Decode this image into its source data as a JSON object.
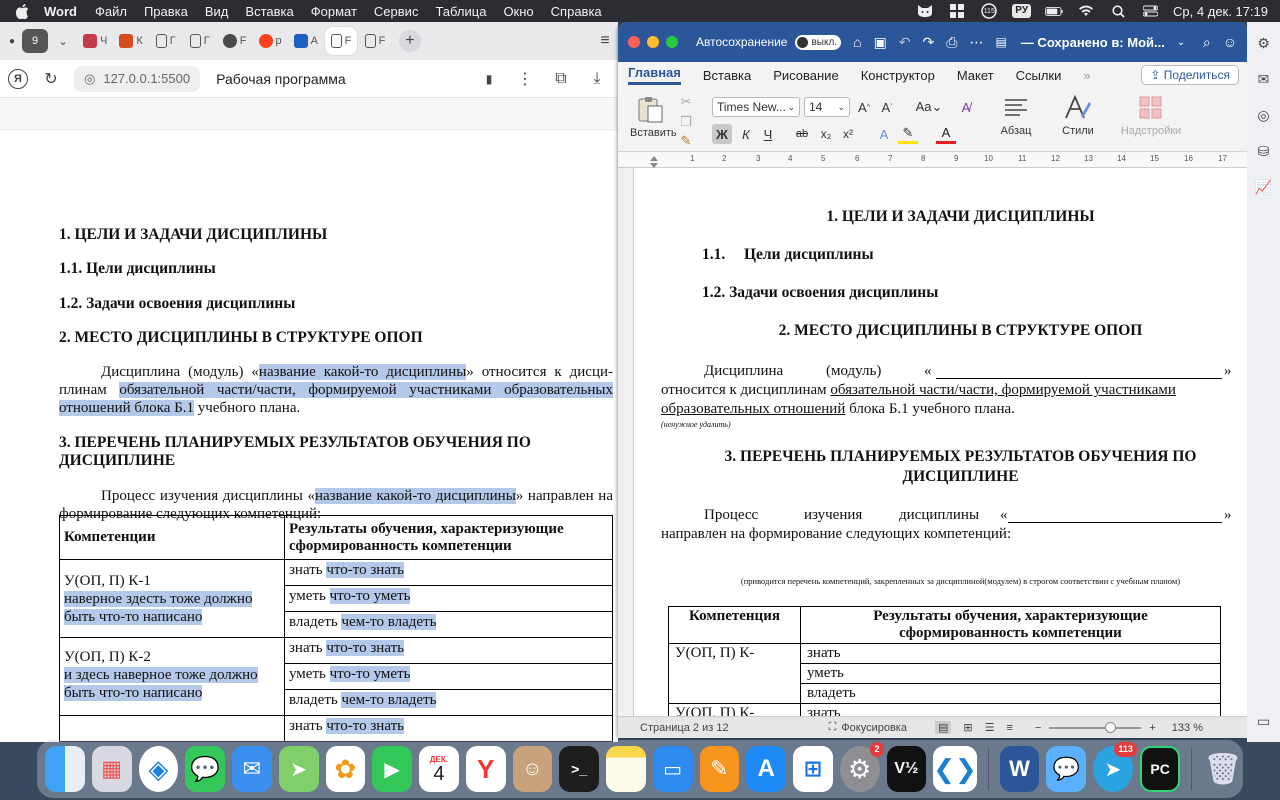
{
  "menubar": {
    "app": "Word",
    "items": [
      "Файл",
      "Правка",
      "Вид",
      "Вставка",
      "Формат",
      "Сервис",
      "Таблица",
      "Окно",
      "Справка"
    ],
    "kb_layout": "РУ",
    "clock": "Ср, 4 дек.  17:19",
    "notif_count": "115"
  },
  "browser": {
    "tab_count": "9",
    "tabs": [
      "Ч",
      "К",
      "Г",
      "Г",
      "F",
      "р",
      "А",
      "F",
      "F"
    ],
    "url": "127.0.0.1:5500",
    "page_title": "Рабочая программа",
    "doc": {
      "h1": "1. ЦЕЛИ И ЗАДАЧИ ДИСЦИПЛИНЫ",
      "h11": "1.1. Цели дисциплины",
      "h12": "1.2. Задачи освоения дисциплины",
      "h2": "2. МЕСТО ДИСЦИПЛИНЫ В СТРУКТУРЕ ОПОП",
      "p1_a": "Дисциплина (модуль) «",
      "p1_hl1": "название какой-то дисциплины",
      "p1_b": "» относится к дисци-плинам ",
      "p1_hl2": "обязательной части/части, формируемой участниками образовательных отношений блока Б.1",
      "p1_c": " учебного плана.",
      "h3": "3. ПЕРЕЧЕНЬ ПЛАНИРУЕМЫХ РЕЗУЛЬТАТОВ ОБУЧЕНИЯ ПО ДИСЦИПЛИНЕ",
      "p2_a": "Процесс изучения дисциплины «",
      "p2_hl": "название какой-то дисциплины",
      "p2_b": "» направлен на формирование следующих компетенций:",
      "table": {
        "col1": "Компетенции",
        "col2": "Результаты обучения, характеризующие сформированность компетенции",
        "rows": [
          {
            "code": "У(ОП, П) К-1",
            "note": "наверное здесть тоже должно быть что-то написано",
            "r": [
              [
                "знать ",
                "что-то знать"
              ],
              [
                "уметь ",
                "что-то уметь"
              ],
              [
                "владеть ",
                "чем-то владеть"
              ]
            ]
          },
          {
            "code": "У(ОП, П) К-2",
            "note": "и здесь наверное тоже должно быть что-то написано",
            "r": [
              [
                "знать ",
                "что-то знать"
              ],
              [
                "уметь ",
                "что-то уметь"
              ],
              [
                "владеть ",
                "чем-то владеть"
              ]
            ]
          },
          {
            "r": [
              [
                "знать ",
                "что-то знать"
              ]
            ]
          }
        ]
      }
    }
  },
  "word": {
    "autosave": "Автосохранение",
    "autosave_state": "выкл.",
    "doc_name": "— Сохранено в: Мой...",
    "tabs": [
      "Главная",
      "Вставка",
      "Рисование",
      "Конструктор",
      "Макет",
      "Ссылки"
    ],
    "share": "Поделиться",
    "paste": "Вставить",
    "font_name": "Times New...",
    "font_size": "14",
    "paragraph": "Абзац",
    "styles": "Стили",
    "addins": "Надстройки",
    "bold": "Ж",
    "italic": "К",
    "underline": "Ч",
    "doc": {
      "h1": "1. ЦЕЛИ И ЗАДАЧИ ДИСЦИПЛИНЫ",
      "h11_num": "1.1.",
      "h11": "Цели дисциплины",
      "h12": "1.2. Задачи освоения дисциплины",
      "h2": "2. МЕСТО ДИСЦИПЛИНЫ В СТРУКТУРЕ ОПОП",
      "p1_a": "Дисциплина",
      "p1_b": "(модуль)",
      "p1_c": "«",
      "p1_d": "»",
      "p1_line2a": "относится к дисциплинам ",
      "p1_line2u": "обязательной части/части, формируемой участниками",
      "p1_line3u": "образовательных отношений",
      "p1_line3b": " блока Б.1 учебного плана.",
      "small_note": "(ненужное удалить)",
      "h3a": "3. ПЕРЕЧЕНЬ ПЛАНИРУЕМЫХ РЕЗУЛЬТАТОВ ОБУЧЕНИЯ ПО",
      "h3b": "ДИСЦИПЛИНЕ",
      "p2_a": "Процесс",
      "p2_b": "изучения",
      "p2_c": "дисциплины",
      "p2_d": "«",
      "p2_e": "»",
      "p2_line2": "направлен на формирование следующих компетенций:",
      "note2": "(приводится перечень компетенций, закрепленных за дисциплиной(модулем) в строгом соответствии с учебным планом)",
      "table": {
        "col1": "Компетенция",
        "col2": "Результаты обучения, характеризующие сформированность компетенции",
        "code": "У(ОП, П) К-",
        "r1": "знать",
        "r2": "уметь",
        "r3": "владеть",
        "code2": "У(ОП, П) К-",
        "r4": "знать"
      }
    },
    "status": {
      "page": "Страница 2 из 12",
      "focus": "Фокусировка",
      "zoom": "133 %"
    }
  },
  "dock": {
    "calendar_month": "ДЕК.",
    "calendar_day": "4",
    "settings_badge": "2",
    "telegram_badge": "113"
  }
}
